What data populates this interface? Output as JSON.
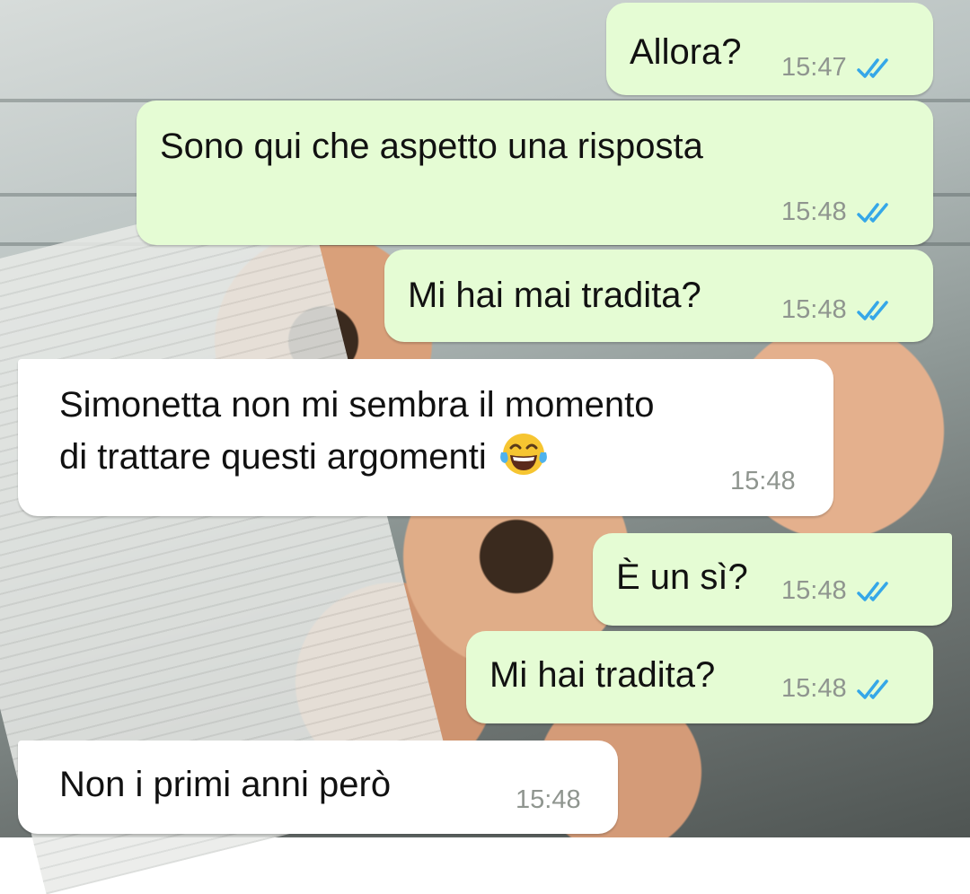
{
  "messages": [
    {
      "direction": "outgoing",
      "text": "Allora?",
      "time": "15:47",
      "status": "read"
    },
    {
      "direction": "outgoing",
      "text": "Sono qui che aspetto una risposta",
      "time": "15:48",
      "status": "read"
    },
    {
      "direction": "outgoing",
      "text": "Mi hai mai tradita?",
      "time": "15:48",
      "status": "read"
    },
    {
      "direction": "incoming",
      "line1": "Simonetta non mi sembra il momento",
      "line2": "di trattare questi argomenti",
      "emoji": "laughing-tears-emoji",
      "time": "15:48"
    },
    {
      "direction": "outgoing",
      "text": "È un sì?",
      "time": "15:48",
      "status": "read"
    },
    {
      "direction": "outgoing",
      "text": "Mi hai tradita?",
      "time": "15:48",
      "status": "read"
    },
    {
      "direction": "incoming",
      "text": "Non i primi anni però",
      "time": "15:48"
    }
  ],
  "colors": {
    "outgoing_bubble": "#e5fcd4",
    "incoming_bubble": "#ffffff",
    "read_tick": "#35a7e8",
    "time_text": "#8f958f"
  }
}
